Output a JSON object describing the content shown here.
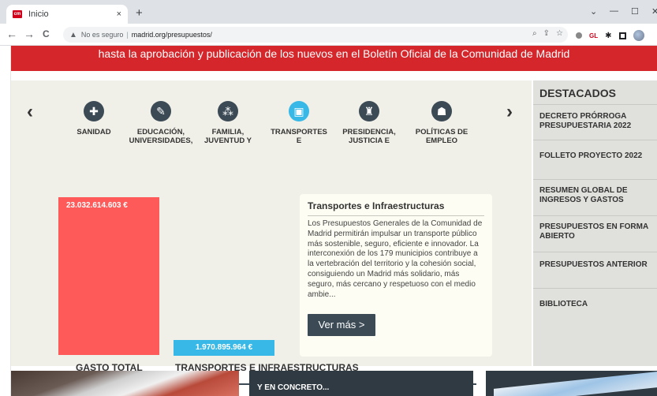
{
  "browser": {
    "tab_title": "Inicio",
    "tab_close": "×",
    "new_tab": "+",
    "window_controls": [
      "⌄",
      "—",
      "☐",
      "✕"
    ],
    "nav": {
      "back": "←",
      "forward": "→",
      "reload": "C"
    },
    "security_label": "No es seguro",
    "url": "madrid.org/presupuestos/",
    "extension_label": "GL"
  },
  "banner": {
    "text": "hasta la aprobación y publicación de los nuevos en el Boletín Oficial de la Comunidad de Madrid"
  },
  "carousel": {
    "prev": "‹",
    "next": "›",
    "categories": [
      {
        "label": "SANIDAD",
        "icon": "health-cross-icon"
      },
      {
        "label": "EDUCACIÓN,\nUNIVERSIDADES,",
        "icon": "education-icon"
      },
      {
        "label": "FAMILIA,\nJUVENTUD Y",
        "icon": "family-icon"
      },
      {
        "label": "TRANSPORTES\nE",
        "icon": "transport-icon"
      },
      {
        "label": "PRESIDENCIA,\nJUSTICIA E",
        "icon": "presidency-icon"
      },
      {
        "label": "POLÍTICAS DE\nEMPLEO",
        "icon": "employment-icon"
      }
    ]
  },
  "budget": {
    "total_value": "23.032.614.603 €",
    "transport_value": "1.970.895.964 €",
    "total_label": "GASTO TOTAL",
    "transport_label": "TRANSPORTES E INFRAESTRUCTURAS"
  },
  "info": {
    "title": "Transportes e Infraestructuras",
    "text": "Los Presupuestos Generales de la Comunidad de Madrid permitirán impulsar un transporte público más sostenible, seguro, eficiente e innovador. La interconexión de los 179 municipios contribuye a la vertebración del territorio y la cohesión social, consiguiendo un Madrid más solidario, más seguro, más cercano y respetuoso con el medio ambie...",
    "button": "Ver más >"
  },
  "destacados": {
    "title": "DESTACADOS",
    "items": [
      "DECRETO PRÓRROGA\nPRESUPUESTARIA 2022",
      "FOLLETO PROYECTO 2022",
      "RESUMEN GLOBAL DE\nINGRESOS Y GASTOS",
      "PRESUPUESTOS EN FORMA\nABIERTO",
      "PRESUPUESTOS ANTERIOR",
      "BIBLIOTECA"
    ]
  },
  "cards": {
    "concreto_label": "Y EN CONCRETO..."
  },
  "colors": {
    "banner_red": "#d5262b",
    "total_bar": "#ff5a5a",
    "transport_bar": "#37b8e6",
    "dark_slate": "#3b4a55"
  }
}
